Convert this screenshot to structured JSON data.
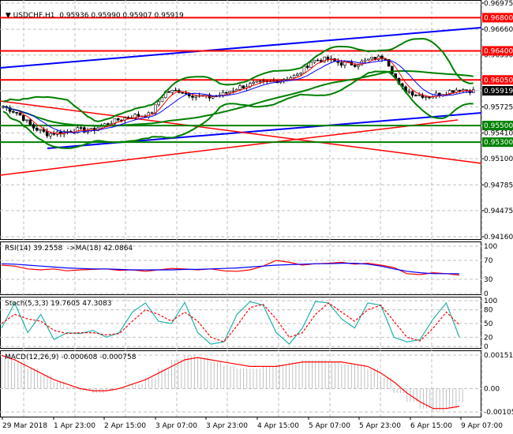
{
  "header": {
    "symbol": "USDCHF,H1",
    "open": "0.95936",
    "high": "0.95990",
    "low": "0.95907",
    "close": "0.95919"
  },
  "colors": {
    "bull": "#000000",
    "bear": "#000000",
    "resistance": "#ff0000",
    "support": "#008000",
    "channel": "#0000ff",
    "current": "#000000"
  },
  "price_axis": [
    "0.96975",
    "0.96660",
    "0.96350",
    "0.95725",
    "0.95410",
    "0.95100",
    "0.94785",
    "0.94475",
    "0.94160"
  ],
  "levels": [
    {
      "value": "0.96800",
      "color": "#ff0000"
    },
    {
      "value": "0.96400",
      "color": "#ff0000"
    },
    {
      "value": "0.96050",
      "color": "#ff0000"
    },
    {
      "value": "0.95919",
      "color": "#000000"
    },
    {
      "value": "0.95500",
      "color": "#008000"
    },
    {
      "value": "0.95300",
      "color": "#008000"
    }
  ],
  "rsi": {
    "label": "RSI(14) 39.2558  ->MA(18) 42.0864",
    "axis": [
      "100",
      "70",
      "30",
      "0"
    ]
  },
  "stoch": {
    "label": "Stoch(5,3,3) 19.7605 47.3083",
    "axis": [
      "100",
      "80",
      "50",
      "20",
      "0"
    ]
  },
  "macd": {
    "label": "MACD(12,26,9) -0.000608 -0.000758",
    "axis": [
      "0.001513",
      "0.00",
      "-0.001053"
    ]
  },
  "time_axis": [
    "29 Mar 2018",
    "1 Apr 23:00",
    "2 Apr 15:00",
    "3 Apr 07:00",
    "3 Apr 23:00",
    "4 Apr 15:00",
    "5 Apr 07:00",
    "5 Apr 23:00",
    "6 Apr 15:00",
    "9 Apr 07:00"
  ],
  "chart_data": {
    "type": "candlestick",
    "symbol": "USDCHF",
    "timeframe": "H1",
    "ylim": [
      0.9416,
      0.96975
    ],
    "close_path": [
      0.9573,
      0.9565,
      0.9548,
      0.954,
      0.9542,
      0.9545,
      0.9544,
      0.9552,
      0.9558,
      0.9562,
      0.9563,
      0.959,
      0.9592,
      0.9586,
      0.9584,
      0.9588,
      0.9596,
      0.96,
      0.9602,
      0.9606,
      0.961,
      0.9628,
      0.963,
      0.9625,
      0.9624,
      0.963,
      0.9633,
      0.9596,
      0.9588,
      0.9585,
      0.959,
      0.9594,
      0.95919
    ],
    "rsi": [
      60,
      58,
      52,
      50,
      52,
      48,
      50,
      51,
      52,
      49,
      50,
      47,
      50,
      53,
      52,
      50,
      52,
      48,
      47,
      50,
      58,
      70,
      66,
      60,
      63,
      64,
      66,
      62,
      64,
      60,
      55,
      42,
      40,
      44,
      42,
      39
    ],
    "rsi_ma": [
      63,
      62,
      60,
      58,
      56,
      54,
      53,
      52,
      52,
      51,
      50,
      50,
      50,
      50,
      51,
      51,
      52,
      53,
      54,
      56,
      58,
      60,
      61,
      62,
      63,
      63,
      64,
      64,
      62,
      58,
      52,
      47,
      44,
      42,
      42,
      42
    ],
    "stoch_main": [
      40,
      95,
      30,
      70,
      15,
      30,
      28,
      35,
      20,
      30,
      75,
      95,
      55,
      50,
      96,
      30,
      5,
      10,
      70,
      98,
      90,
      30,
      5,
      40,
      98,
      95,
      60,
      40,
      95,
      90,
      20,
      10,
      15,
      60,
      95,
      20
    ],
    "stoch_signal": [
      50,
      70,
      60,
      55,
      35,
      28,
      30,
      30,
      25,
      28,
      55,
      80,
      70,
      55,
      75,
      55,
      20,
      10,
      45,
      85,
      92,
      60,
      20,
      30,
      70,
      95,
      75,
      55,
      80,
      90,
      55,
      20,
      12,
      40,
      75,
      47
    ],
    "macd_hist": [
      14,
      12,
      9,
      6,
      3,
      1,
      -1,
      -2,
      -1,
      0,
      2,
      5,
      9,
      13,
      15,
      14,
      12,
      10,
      9,
      9,
      10,
      11,
      12,
      13,
      13,
      12,
      11,
      11,
      9,
      5,
      -2,
      -6,
      -9,
      -10,
      -9,
      -6
    ],
    "macd_signal": [
      15,
      13,
      10,
      7,
      4,
      2,
      0,
      -1,
      -1,
      0,
      2,
      4,
      7,
      10,
      13,
      14,
      13,
      12,
      11,
      10,
      10,
      10,
      11,
      12,
      12,
      12,
      12,
      11,
      10,
      7,
      3,
      -2,
      -6,
      -9,
      -9,
      -8
    ],
    "macd_ylim": [
      -0.001053,
      0.001513
    ]
  }
}
